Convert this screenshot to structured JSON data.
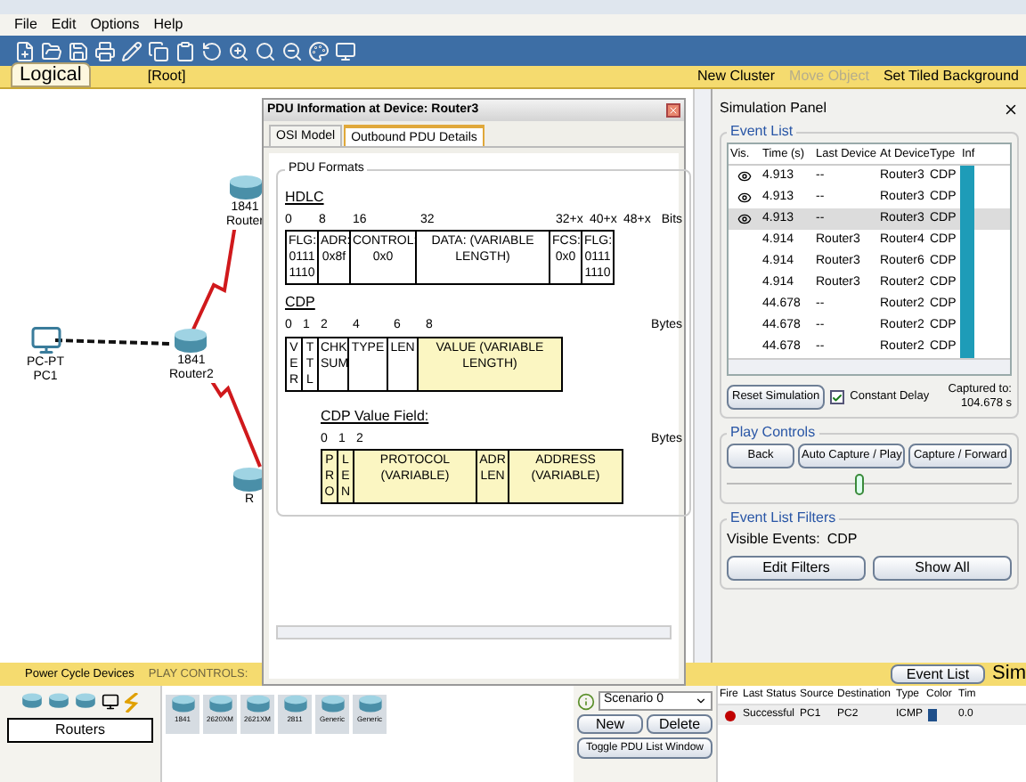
{
  "menu": [
    "File",
    "Edit",
    "Options",
    "Help"
  ],
  "workspace_bar": {
    "mode": "Logical",
    "path": "[Root]",
    "buttons": [
      {
        "label": "New Cluster",
        "disabled": false
      },
      {
        "label": "Move Object",
        "disabled": true
      },
      {
        "label": "Set Tiled Background",
        "disabled": false
      }
    ]
  },
  "canvas": {
    "nodes": [
      {
        "kind": "router",
        "model": "1841",
        "name": "Router"
      },
      {
        "kind": "pc",
        "model": "PC-PT",
        "name": "PC1"
      },
      {
        "kind": "router",
        "model": "1841",
        "name": "Router2"
      },
      {
        "kind": "router",
        "name": "R"
      }
    ],
    "links": [
      {
        "kind": "ethernet"
      },
      {
        "kind": "serial"
      },
      {
        "kind": "serial"
      }
    ]
  },
  "pdu_dialog": {
    "title": "PDU Information at Device: Router3",
    "tabs": [
      {
        "label": "OSI Model",
        "selected": false
      },
      {
        "label": "Outbound PDU Details",
        "selected": true
      }
    ],
    "group": "PDU Formats",
    "formats": [
      {
        "title": "HDLC",
        "ticks": [
          "0",
          "8",
          "16",
          "32",
          "32+x",
          "40+x",
          "48+x"
        ],
        "unit": "Bits",
        "fields": [
          {
            "text": "FLG:\n0111\n1110",
            "highlighted": false
          },
          {
            "text": "ADR:\n0x8f",
            "highlighted": false
          },
          {
            "text": "CONTROL:\n0x0",
            "highlighted": false
          },
          {
            "text": "DATA: (VARIABLE\nLENGTH)",
            "highlighted": false
          },
          {
            "text": "FCS:\n0x0",
            "highlighted": false
          },
          {
            "text": "FLG:\n0111\n1110",
            "highlighted": false
          }
        ]
      },
      {
        "title": "CDP",
        "ticks": [
          "0",
          "1",
          "2",
          "4",
          "6",
          "8"
        ],
        "unit": "Bytes",
        "fields": [
          {
            "text": "V\nE\nR",
            "highlighted": false
          },
          {
            "text": "T\nT\nL",
            "highlighted": false
          },
          {
            "text": "CHK\nSUM",
            "highlighted": false
          },
          {
            "text": "TYPE",
            "highlighted": false
          },
          {
            "text": "LEN",
            "highlighted": false
          },
          {
            "text": "VALUE (VARIABLE LENGTH)",
            "highlighted": true
          }
        ]
      },
      {
        "title": "CDP Value Field:",
        "ticks": [
          "0",
          "1",
          "2"
        ],
        "unit": "Bytes",
        "fields": [
          {
            "text": "P\nR\nO",
            "highlighted": true
          },
          {
            "text": "L\nE\nN",
            "highlighted": true
          },
          {
            "text": "PROTOCOL (VARIABLE)",
            "highlighted": true
          },
          {
            "text": "ADR\nLEN",
            "highlighted": true
          },
          {
            "text": "ADDRESS (VARIABLE)",
            "highlighted": true
          }
        ]
      }
    ]
  },
  "sim_panel": {
    "title": "Simulation Panel",
    "event_list": {
      "title": "Event List",
      "columns": [
        "Vis.",
        "Time (s)",
        "Last Device",
        "At Device",
        "Type",
        "Inf"
      ],
      "rows": [
        {
          "visible": true,
          "time": "4.913",
          "last": "--",
          "at": "Router3",
          "type": "CDP",
          "selected": false,
          "color": "#1e9cb8"
        },
        {
          "visible": true,
          "time": "4.913",
          "last": "--",
          "at": "Router3",
          "type": "CDP",
          "selected": false,
          "color": "#1e9cb8"
        },
        {
          "visible": true,
          "time": "4.913",
          "last": "--",
          "at": "Router3",
          "type": "CDP",
          "selected": true,
          "color": "#1e9cb8"
        },
        {
          "visible": false,
          "time": "4.914",
          "last": "Router3",
          "at": "Router4",
          "type": "CDP",
          "selected": false,
          "color": "#1e9cb8"
        },
        {
          "visible": false,
          "time": "4.914",
          "last": "Router3",
          "at": "Router6",
          "type": "CDP",
          "selected": false,
          "color": "#1e9cb8"
        },
        {
          "visible": false,
          "time": "4.914",
          "last": "Router3",
          "at": "Router2",
          "type": "CDP",
          "selected": false,
          "color": "#1e9cb8"
        },
        {
          "visible": false,
          "time": "44.678",
          "last": "--",
          "at": "Router2",
          "type": "CDP",
          "selected": false,
          "color": "#1e9cb8"
        },
        {
          "visible": false,
          "time": "44.678",
          "last": "--",
          "at": "Router2",
          "type": "CDP",
          "selected": false,
          "color": "#1e9cb8"
        },
        {
          "visible": false,
          "time": "44.678",
          "last": "--",
          "at": "Router2",
          "type": "CDP",
          "selected": false,
          "color": "#1e9cb8"
        }
      ]
    },
    "reset_button": "Reset Simulation",
    "constant_delay": {
      "label": "Constant Delay",
      "checked": true
    },
    "captured": {
      "label": "Captured to:",
      "value": "104.678 s"
    },
    "play_controls": {
      "title": "Play Controls",
      "buttons": [
        "Back",
        "Auto Capture / Play",
        "Capture / Forward"
      ],
      "level": 0.47
    },
    "filters": {
      "title": "Event List Filters",
      "label": "Visible Events:",
      "value": "CDP",
      "buttons": [
        "Edit Filters",
        "Show All"
      ]
    }
  },
  "bottom_bar": {
    "buttons": [
      {
        "label": "Power Cycle Devices",
        "disabled": false
      },
      {
        "label": "PLAY CONTROLS:",
        "disabled": true
      }
    ],
    "event_list_button": "Event List",
    "mode": "Sim"
  },
  "device_box": {
    "category": "Routers",
    "models": [
      "1841",
      "2620XM",
      "2621XM",
      "2811",
      "Generic",
      "Generic"
    ]
  },
  "scenario": {
    "value": "Scenario 0",
    "buttons": [
      "New",
      "Delete",
      "Toggle PDU List Window"
    ]
  },
  "pdu_list": {
    "columns": [
      "Fire",
      "Last Status",
      "Source",
      "Destination",
      "Type",
      "Color",
      "Tim"
    ],
    "rows": [
      {
        "status": "Successful",
        "source": "PC1",
        "destination": "PC2",
        "type": "ICMP",
        "color": "#1f4f8a",
        "time": "0.0"
      }
    ]
  }
}
